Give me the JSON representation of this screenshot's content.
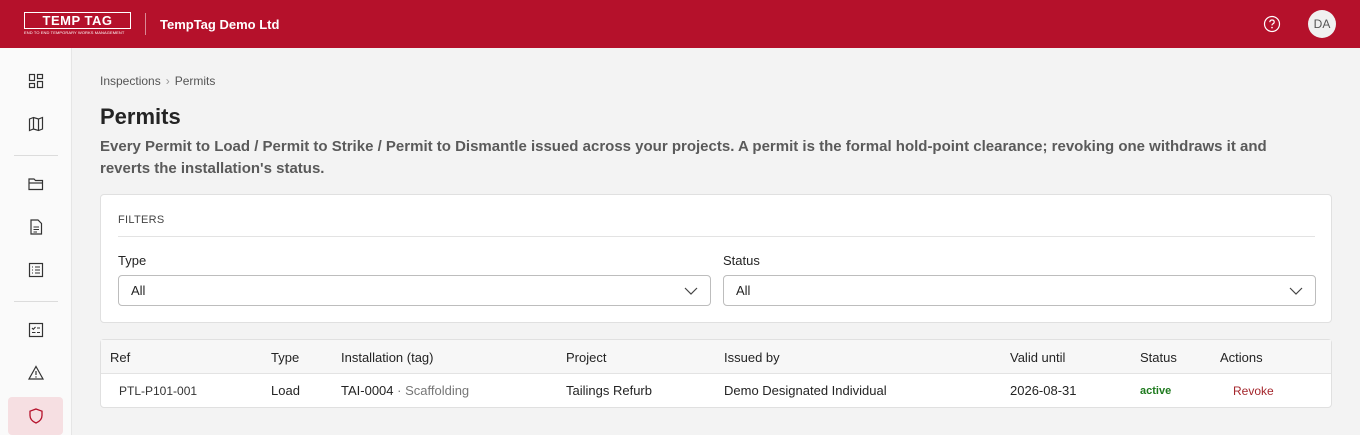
{
  "header": {
    "logo_text": "TEMP TAG",
    "logo_tagline": "END TO END TEMPORARY WORKS MANAGEMENT",
    "org_name": "TempTag Demo Ltd",
    "avatar_initials": "DA",
    "brand_color": "#b5112b"
  },
  "sidebar": {
    "items": [
      {
        "icon": "dashboard-icon"
      },
      {
        "icon": "map-icon"
      },
      {
        "icon": "folder-icon"
      },
      {
        "icon": "document-icon"
      },
      {
        "icon": "list-icon"
      },
      {
        "icon": "checklist-icon"
      },
      {
        "icon": "warning-icon"
      },
      {
        "icon": "shield-icon",
        "active": true
      }
    ]
  },
  "breadcrumb": {
    "items": [
      "Inspections",
      "Permits"
    ],
    "separator": "›"
  },
  "page": {
    "title": "Permits",
    "subtitle": "Every Permit to Load / Permit to Strike / Permit to Dismantle issued across your projects. A permit is the formal hold-point clearance; revoking one withdraws it and reverts the installation's status."
  },
  "filters": {
    "title": "FILTERS",
    "type_label": "Type",
    "type_value": "All",
    "status_label": "Status",
    "status_value": "All"
  },
  "table": {
    "columns": [
      "Ref",
      "Type",
      "Installation (tag)",
      "Project",
      "Issued by",
      "Valid until",
      "Status",
      "Actions"
    ],
    "rows": [
      {
        "ref": "PTL-P101-001",
        "type": "Load",
        "installation_tag": "TAI-0004",
        "installation_sep": " · ",
        "installation_kind": "Scaffolding",
        "project": "Tailings Refurb",
        "issued_by": "Demo Designated Individual",
        "valid_until": "2026-08-31",
        "status": "active",
        "action": "Revoke"
      }
    ]
  },
  "colors": {
    "status_active": "#1e7a1e",
    "revoke": "#a4262c"
  }
}
